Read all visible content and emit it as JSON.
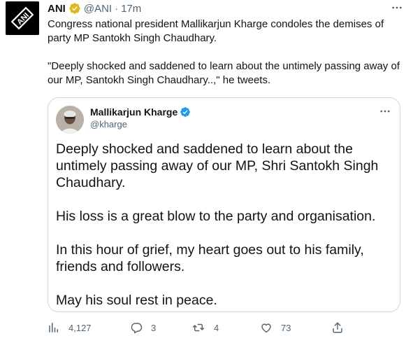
{
  "tweet": {
    "author_name": "ANI",
    "handle": "@ANI",
    "separator": "·",
    "time": "17m",
    "avatar_icon": "ani-logo",
    "paragraphs": [
      "Congress national president Mallikarjun Kharge condoles the demises of party MP Santokh Singh Chaudhary.",
      "\"Deeply shocked and saddened to learn about the untimely passing away of our MP, Santokh Singh Chaudhary..,\" he tweets."
    ]
  },
  "quote": {
    "author_name": "Mallikarjun Kharge",
    "handle": "@kharge",
    "paragraphs": [
      "Deeply shocked and saddened to learn about the untimely passing away of our MP, Shri Santokh Singh Chaudhary.",
      "His loss is a great blow to the party and organisation.",
      "In this hour of grief, my heart goes out to his family, friends and followers.",
      "May his soul rest in peace."
    ]
  },
  "actions": {
    "views": "4,127",
    "replies": "3",
    "retweets": "4",
    "likes": "73"
  },
  "icons": {
    "verified_gold": "verified-gold-badge",
    "verified_blue": "verified-blue-badge",
    "more": "more-horizontal-icon",
    "views": "bar-chart-icon",
    "reply": "reply-icon",
    "retweet": "retweet-icon",
    "like": "heart-icon",
    "share": "share-icon"
  },
  "colors": {
    "text_primary": "#0f1419",
    "text_secondary": "#536471",
    "border": "#cfd9de",
    "verified_gold": "#e2b719",
    "verified_blue": "#1d9bf0"
  }
}
